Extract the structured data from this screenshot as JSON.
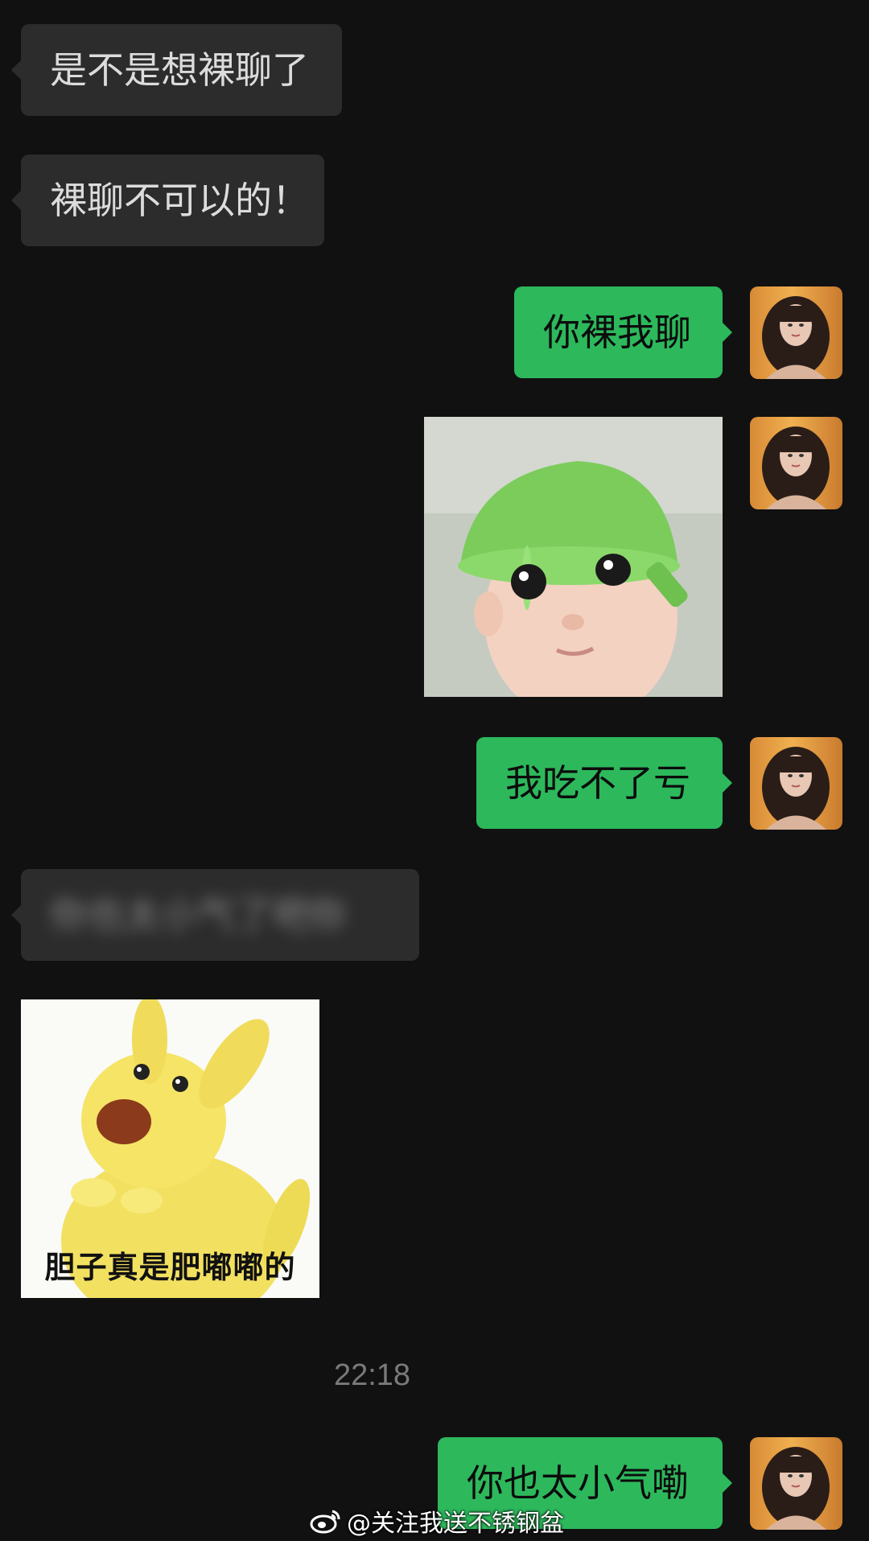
{
  "messages": {
    "m1": "是不是想裸聊了",
    "m2": "裸聊不可以的！",
    "m3": "你裸我聊",
    "m5": "我吃不了亏",
    "m6_blurred": "你也太小气了吧你",
    "m7_caption": "胆子真是肥嘟嘟的",
    "m8": "你也太小气嘞"
  },
  "timestamp": "22:18",
  "watermark": "@关注我送不锈钢盆",
  "colors": {
    "background": "#111111",
    "incoming_bubble": "#2c2c2c",
    "outgoing_bubble": "#2db85c"
  },
  "icons": {
    "watermark": "weibo-logo-icon"
  }
}
